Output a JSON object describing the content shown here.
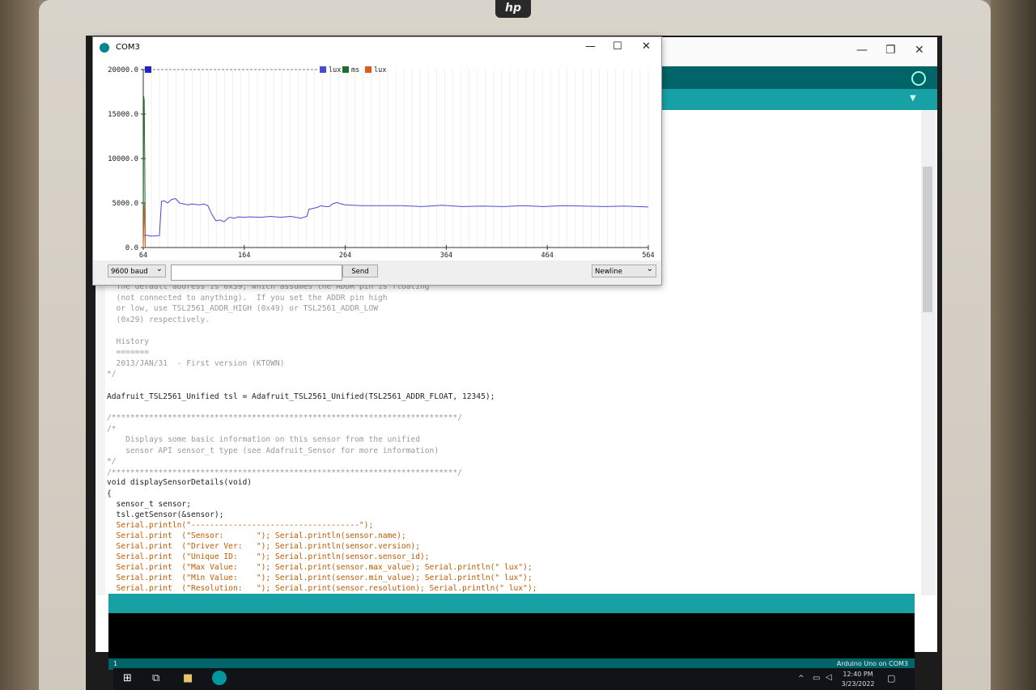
{
  "plotter": {
    "title": "COM3",
    "controls": {
      "baud": "9600 baud",
      "send_label": "Send",
      "line_ending": "Newline",
      "command_value": ""
    }
  },
  "chart_data": {
    "type": "line",
    "xlim": [
      64,
      564
    ],
    "ylim": [
      0,
      20000
    ],
    "x_ticks": [
      "64",
      "164",
      "264",
      "364",
      "464",
      "564"
    ],
    "y_ticks": [
      "0.0",
      "5000.0",
      "10000.0",
      "15000.0",
      "20000.0"
    ],
    "legend": [
      "lux",
      "ms",
      "lux"
    ],
    "legend_placement": "top",
    "grid": true,
    "series": [
      {
        "name": "lux",
        "color": "#4a4ad8",
        "x": [
          64,
          67,
          70,
          73,
          75,
          80,
          82,
          85,
          88,
          92,
          96,
          100,
          104,
          108,
          112,
          116,
          120,
          124,
          128,
          132,
          136,
          140,
          144,
          148,
          150,
          154,
          158,
          164,
          170,
          180,
          190,
          200,
          210,
          220,
          226,
          228,
          232,
          236,
          240,
          244,
          248,
          252,
          256,
          260,
          264,
          280,
          300,
          320,
          340,
          360,
          380,
          400,
          420,
          440,
          460,
          480,
          500,
          520,
          540,
          564
        ],
        "y": [
          1300,
          1400,
          1300,
          1300,
          1300,
          1350,
          5200,
          5250,
          5000,
          5400,
          5500,
          5000,
          4900,
          4800,
          4900,
          4850,
          4800,
          4900,
          4700,
          3700,
          3000,
          3100,
          2900,
          3300,
          3400,
          3300,
          3450,
          3400,
          3450,
          3400,
          3500,
          3400,
          3500,
          3300,
          3500,
          4300,
          4400,
          4500,
          4700,
          4600,
          4600,
          4950,
          5050,
          4900,
          4800,
          4700,
          4700,
          4700,
          4600,
          4750,
          4600,
          4650,
          4600,
          4700,
          4600,
          4700,
          4650,
          4600,
          4650,
          4550
        ]
      },
      {
        "name": "ms",
        "color": "#1e6f2a",
        "x": [
          64,
          64.5,
          65,
          65.5,
          66
        ],
        "y": [
          0,
          17000,
          16500,
          9000,
          0
        ]
      },
      {
        "name": "lux",
        "color": "#e05a1e",
        "x": [
          64,
          65,
          66
        ],
        "y": [
          0,
          5000,
          0
        ]
      }
    ]
  },
  "editor": {
    "lines": [
      "  The default address is 0x39, which assumes the ADDR pin is floating",
      "  (not connected to anything).  If you set the ADDR pin high",
      "  or low, use TSL2561_ADDR_HIGH (0x49) or TSL2561_ADDR_LOW",
      "  (0x29) respectively.",
      "",
      "  History",
      "  =======",
      "  2013/JAN/31  - First version (KTOWN)",
      "*/",
      "",
      "Adafruit_TSL2561_Unified tsl = Adafruit_TSL2561_Unified(TSL2561_ADDR_FLOAT, 12345);",
      "",
      "/**************************************************************************/",
      "/*",
      "    Displays some basic information on this sensor from the unified",
      "    sensor API sensor_t type (see Adafruit_Sensor for more information)",
      "*/",
      "/**************************************************************************/",
      "void displaySensorDetails(void)",
      "{",
      "  sensor_t sensor;",
      "  tsl.getSensor(&sensor);",
      "  Serial.println(\"------------------------------------\");",
      "  Serial.print  (\"Sensor:       \"); Serial.println(sensor.name);",
      "  Serial.print  (\"Driver Ver:   \"); Serial.println(sensor.version);",
      "  Serial.print  (\"Unique ID:    \"); Serial.println(sensor.sensor_id);",
      "  Serial.print  (\"Max Value:    \"); Serial.print(sensor.max_value); Serial.println(\" lux\");",
      "  Serial.print  (\"Min Value:    \"); Serial.print(sensor.min_value); Serial.println(\" lux\");",
      "  Serial.print  (\"Resolution:   \"); Serial.print(sensor.resolution); Serial.println(\" lux\");"
    ]
  },
  "status": {
    "line_number": "1",
    "board": "Arduino Uno on COM3"
  },
  "taskbar": {
    "time": "12:40 PM",
    "date": "3/23/2022"
  },
  "brand": {
    "logo_text": "hp"
  },
  "colors": {
    "arduino_dark": "#006468",
    "arduino_teal": "#17a1a5"
  }
}
